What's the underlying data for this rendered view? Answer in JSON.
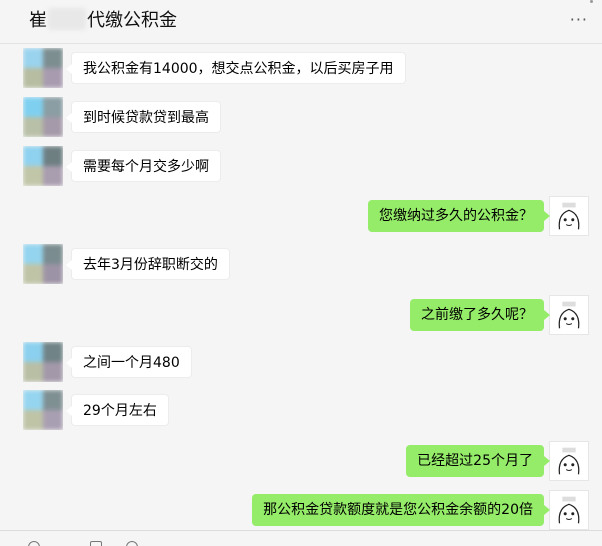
{
  "header": {
    "title_prefix": "崔",
    "title_suffix": "代缴公积金",
    "more_label": "···"
  },
  "messages": [
    {
      "side": "in",
      "text": "我公积金有14000，想交点公积金，以后买房子用"
    },
    {
      "side": "in",
      "text": "到时候贷款贷到最高"
    },
    {
      "side": "in",
      "text": "需要每个月交多少啊"
    },
    {
      "side": "out",
      "text": "您缴纳过多久的公积金？"
    },
    {
      "side": "in",
      "text": "去年3月份辞职断交的"
    },
    {
      "side": "out",
      "text": "之前缴了多久呢？"
    },
    {
      "side": "in",
      "text": "之间一个月480"
    },
    {
      "side": "in",
      "text": "29个月左右"
    },
    {
      "side": "out",
      "text": "已经超过25个月了"
    },
    {
      "side": "out",
      "text": "那公积金贷款额度就是您公积金余额的20倍"
    }
  ],
  "colors": {
    "outgoing_bubble": "#95ec69",
    "incoming_bubble": "#ffffff",
    "background": "#f5f5f5"
  },
  "icons": {
    "incoming_avatar": "blurred-avatar-icon",
    "outgoing_avatar": "cartoon-sticker-avatar-icon",
    "more": "more-dots-icon"
  }
}
